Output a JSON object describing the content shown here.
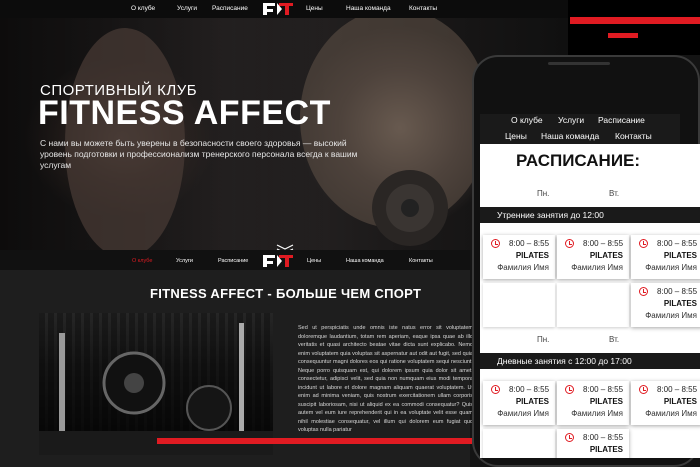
{
  "nav_top": {
    "items": [
      "О клубе",
      "Услуги",
      "Расписание",
      "Цены",
      "Наша команда",
      "Контакты"
    ]
  },
  "hero": {
    "subtitle": "СПОРТИВНЫЙ КЛУБ",
    "title": "FITNESS AFFECT",
    "description": "С нами вы можете быть уверены в безопасности своего здоровья — высокий уровень подготовки и профессионализм тренерского персонала всегда к вашим услугам"
  },
  "nav_second": {
    "items": [
      "О клубе",
      "Услуги",
      "Расписание",
      "Цены",
      "Наша команда",
      "Контакты"
    ]
  },
  "section2": {
    "heading": "FITNESS AFFECT - БОЛЬШЕ ЧЕМ СПОРТ",
    "body": "Sed ut perspiciatis unde omnis iste natus error sit voluptatem doloremque laudantium, totam rem aperiam, eaque ipsa quae ab illo veritatis et quasi architecto beatae vitae dicta sunt explicabo. Nemo enim voluptatem quia voluptas sit aspernatur aut odit aut fugit, sed quia consequuntur magni dolores eos qui ratione voluptatem sequi nesciunt. Neque porro quisquam est, qui dolorem ipsum quia dolor sit amet, consectetur, adipisci velit, sed quia non numquam eius modi tempora incidunt ut labore et dolore magnam aliquam quaerat voluptatem. Ut enim ad minima veniam, quis nostrum exercitationem ullam corporis suscipit laboriosam, nisi ut aliquid ex ea commodi consequatur? Quis autem vel eum iure reprehenderit qui in ea voluptate velit esse quam nihil molestiae consequatur, vel illum qui dolorem eum fugiat quo voluptas nulla pariatur"
  },
  "phone": {
    "nav_row1": [
      "О клубе",
      "Услуги",
      "Расписание"
    ],
    "nav_row2": [
      "Цены",
      "Наша команда",
      "Контакты"
    ],
    "schedule_title": "РАСПИСАНИЕ:",
    "days": [
      "Пн.",
      "Вт."
    ],
    "morning_label": "Утренние занятия до 12:00",
    "day_label": "Дневные занятия с 12:00 до 17:00",
    "class": {
      "time": "8:00 – 8:55",
      "name": "PILATES",
      "trainer": "Фамилия Имя"
    }
  },
  "colors": {
    "accent": "#e01b22",
    "dark": "#141414"
  }
}
